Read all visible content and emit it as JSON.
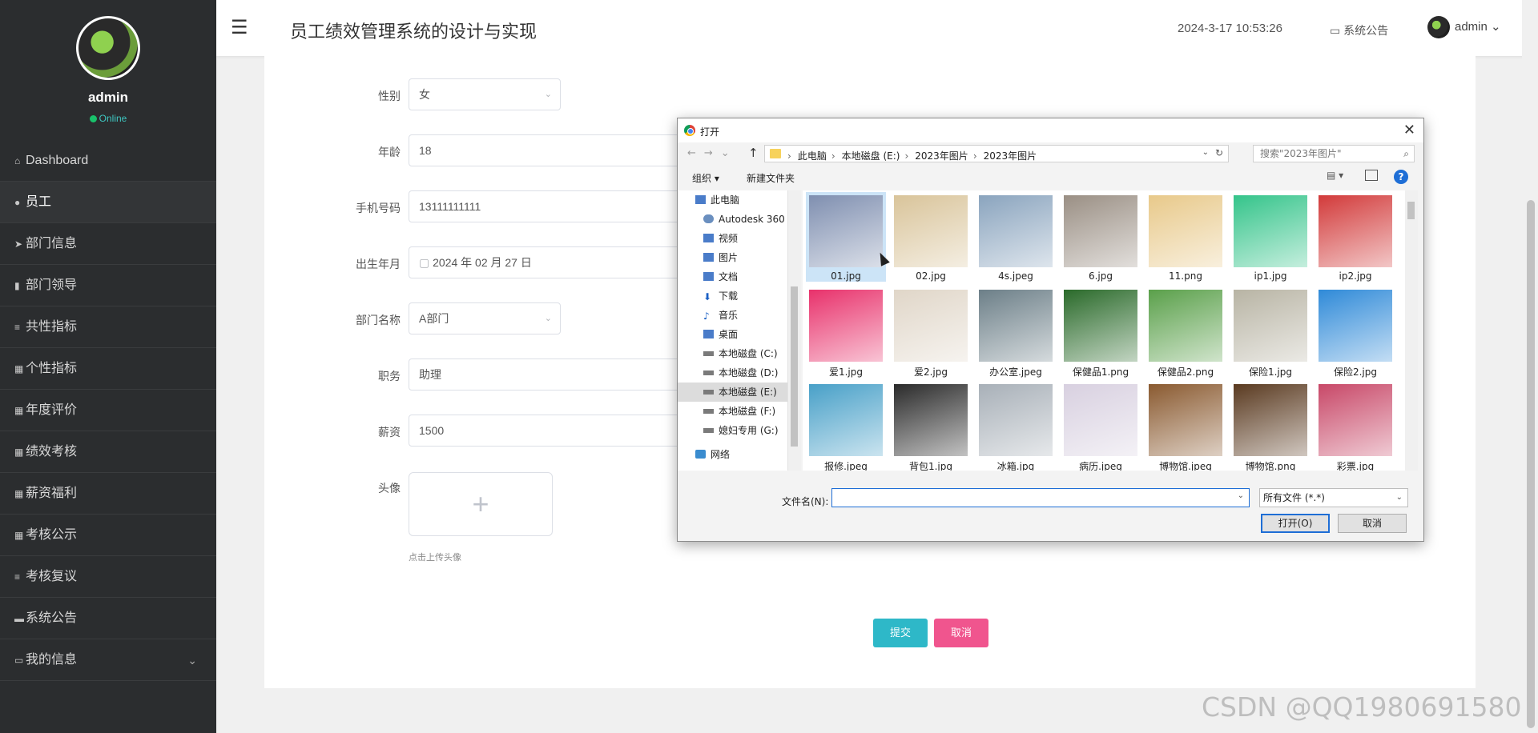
{
  "sidebar": {
    "user_name": "admin",
    "status": "Online",
    "items": [
      {
        "icon": "home-icon",
        "glyph": "⌂",
        "label": "Dashboard"
      },
      {
        "icon": "pin-icon",
        "glyph": "●",
        "label": "员工"
      },
      {
        "icon": "send-icon",
        "glyph": "➤",
        "label": "部门信息"
      },
      {
        "icon": "book-icon",
        "glyph": "▮",
        "label": "部门领导"
      },
      {
        "icon": "list-icon",
        "glyph": "≡",
        "label": "共性指标"
      },
      {
        "icon": "grid-icon",
        "glyph": "▦",
        "label": "个性指标"
      },
      {
        "icon": "grid-icon",
        "glyph": "▦",
        "label": "年度评价"
      },
      {
        "icon": "grid-icon",
        "glyph": "▦",
        "label": "绩效考核"
      },
      {
        "icon": "grid-icon",
        "glyph": "▦",
        "label": "薪资福利"
      },
      {
        "icon": "grid-icon",
        "glyph": "▦",
        "label": "考核公示"
      },
      {
        "icon": "list-icon",
        "glyph": "≡",
        "label": "考核复议"
      },
      {
        "icon": "ticket-icon",
        "glyph": "▬",
        "label": "系统公告"
      },
      {
        "icon": "card-icon",
        "glyph": "▭",
        "label": "我的信息",
        "chevron": "⌄"
      }
    ]
  },
  "header": {
    "menu_glyph": "☰",
    "title": "员工绩效管理系统的设计与实现",
    "datetime": "2024-3-17 10:53:26",
    "notice": "系统公告",
    "user": "admin"
  },
  "form": {
    "gender_label": "性别",
    "gender": "女",
    "age_label": "年龄",
    "age": "18",
    "phone_label": "手机号码",
    "phone": "13111111111",
    "birth_label": "出生年月",
    "birth": "2024 年 02 月 27 日",
    "dept_label": "部门名称",
    "dept": "A部门",
    "position_label": "职务",
    "position": "助理",
    "salary_label": "薪资",
    "salary": "1500",
    "avatar_label": "头像",
    "upload_plus": "+",
    "upload_hint": "点击上传头像",
    "submit": "提交",
    "cancel": "取消"
  },
  "dialog": {
    "title": "打开",
    "close": "✕",
    "breadcrumbs": [
      "此电脑",
      "本地磁盘 (E:)",
      "2023年图片",
      "2023年图片"
    ],
    "search_placeholder": "搜索\"2023年图片\"",
    "organize": "组织 ▾",
    "new_folder": "新建文件夹",
    "help": "?",
    "tree": [
      {
        "label": "此电脑",
        "icon": "computer-icon",
        "level": 1
      },
      {
        "label": "Autodesk 360",
        "icon": "cloud-icon",
        "level": 2
      },
      {
        "label": "视频",
        "icon": "video-icon",
        "level": 2
      },
      {
        "label": "图片",
        "icon": "picture-icon",
        "level": 2
      },
      {
        "label": "文档",
        "icon": "document-icon",
        "level": 2
      },
      {
        "label": "下载",
        "icon": "download-icon",
        "level": 2
      },
      {
        "label": "音乐",
        "icon": "music-icon",
        "level": 2
      },
      {
        "label": "桌面",
        "icon": "desktop-icon",
        "level": 2
      },
      {
        "label": "本地磁盘 (C:)",
        "icon": "drive-icon",
        "level": 2
      },
      {
        "label": "本地磁盘 (D:)",
        "icon": "drive-icon",
        "level": 2
      },
      {
        "label": "本地磁盘 (E:)",
        "icon": "drive-icon",
        "level": 2,
        "selected": true
      },
      {
        "label": "本地磁盘 (F:)",
        "icon": "drive-icon",
        "level": 2
      },
      {
        "label": "媳妇专用 (G:)",
        "icon": "drive-icon",
        "level": 2
      },
      {
        "label": "网络",
        "icon": "network-icon",
        "level": 1
      }
    ],
    "files": [
      {
        "name": "01.jpg",
        "color": "#7f8fb0",
        "selected": true
      },
      {
        "name": "02.jpg",
        "color": "#d9c49a"
      },
      {
        "name": "4s.jpeg",
        "color": "#8aa4be"
      },
      {
        "name": "6.jpg",
        "color": "#9a8f84"
      },
      {
        "name": "11.png",
        "color": "#e8c98a"
      },
      {
        "name": "ip1.jpg",
        "color": "#34c48a"
      },
      {
        "name": "ip2.jpg",
        "color": "#d23a3a"
      },
      {
        "name": "爱1.jpg",
        "color": "#e8316b"
      },
      {
        "name": "爱2.jpg",
        "color": "#e0d6c8"
      },
      {
        "name": "办公室.jpeg",
        "color": "#6c7f88"
      },
      {
        "name": "保健品1.png",
        "color": "#2a6a2a"
      },
      {
        "name": "保健品2.png",
        "color": "#5aa04a"
      },
      {
        "name": "保险1.jpg",
        "color": "#b8b4a4"
      },
      {
        "name": "保险2.jpg",
        "color": "#2f8ad8"
      },
      {
        "name": "报修.jpeg",
        "color": "#48a0c8"
      },
      {
        "name": "背包1.jpg",
        "color": "#2a2a2a"
      },
      {
        "name": "冰箱.jpg",
        "color": "#a8b0b8"
      },
      {
        "name": "病历.jpeg",
        "color": "#d8d0e0"
      },
      {
        "name": "博物馆.jpeg",
        "color": "#8a5a30"
      },
      {
        "name": "博物馆.png",
        "color": "#5a3a20"
      },
      {
        "name": "彩票.jpg",
        "color": "#c84868"
      }
    ],
    "filename_label": "文件名(N):",
    "filename_value": "",
    "file_type": "所有文件 (*.*)",
    "open": "打开(O)",
    "cancel": "取消"
  },
  "watermark": "CSDN @QQ1980691580"
}
